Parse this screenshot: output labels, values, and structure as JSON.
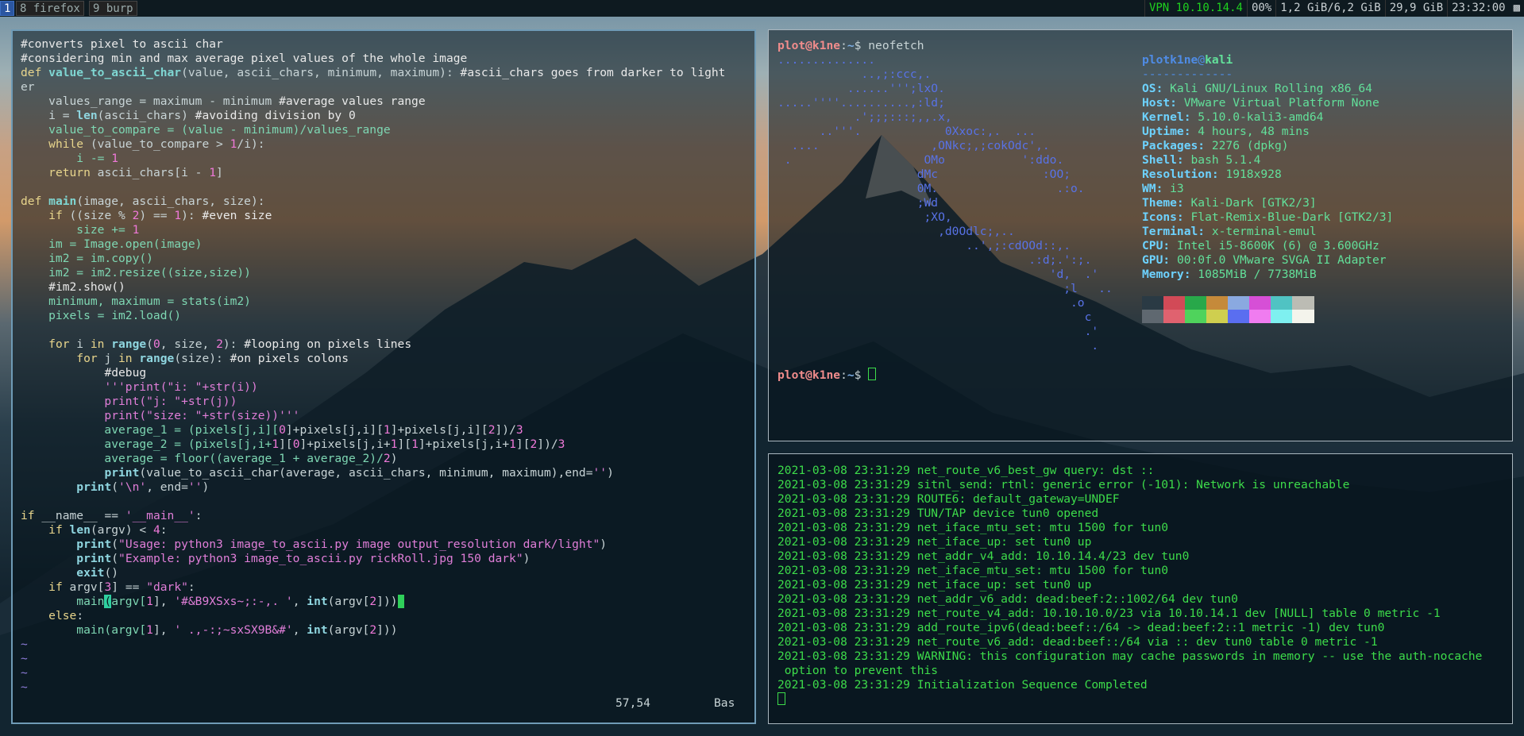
{
  "topbar": {
    "workspaces": [
      {
        "label": "1",
        "active": true
      },
      {
        "label": "8 firefox",
        "active": false
      },
      {
        "label": "9 burp",
        "active": false
      }
    ],
    "status": {
      "vpn": "VPN 10.10.14.4",
      "battery": "00%",
      "memory": "1,2 GiB/6,2 GiB",
      "disk": "29,9 GiB",
      "time": "23:32:00"
    }
  },
  "editor": {
    "lines": [
      "#converts pixel to ascii char",
      "#considering min and max average pixel values of the whole image",
      "def value_to_ascii_char(value, ascii_chars, minimum, maximum): #ascii_chars goes from darker to light",
      "er",
      "    values_range = maximum - minimum #average values range",
      "    i = len(ascii_chars) #avoiding division by 0",
      "    value_to_compare = (value - minimum)/values_range",
      "    while (value_to_compare > 1/i):",
      "        i -= 1",
      "    return ascii_chars[i - 1]",
      "",
      "def main(image, ascii_chars, size):",
      "    if ((size % 2) == 1): #even size",
      "        size += 1",
      "    im = Image.open(image)",
      "    im2 = im.copy()",
      "    im2 = im2.resize((size,size))",
      "    #im2.show()",
      "    minimum, maximum = stats(im2)",
      "    pixels = im2.load()",
      "",
      "    for i in range(0, size, 2): #looping on pixels lines",
      "        for j in range(size): #on pixels colons",
      "            #debug",
      "            '''print(\"i: \"+str(i))",
      "            print(\"j: \"+str(j))",
      "            print(\"size: \"+str(size))'''",
      "            average_1 = (pixels[j,i][0]+pixels[j,i][1]+pixels[j,i][2])/3",
      "            average_2 = (pixels[j,i+1][0]+pixels[j,i+1][1]+pixels[j,i+1][2])/3",
      "            average = floor((average_1 + average_2)/2)",
      "            print(value_to_ascii_char(average, ascii_chars, minimum, maximum),end='')",
      "        print('\\n', end='')",
      "",
      "if __name__ == '__main__':",
      "    if len(argv) < 4:",
      "        print(\"Usage: python3 image_to_ascii.py image output_resolution dark/light\")",
      "        print(\"Example: python3 image_to_ascii.py rickRoll.jpg 150 dark\")",
      "        exit()",
      "    if argv[3] == \"dark\":",
      "        main(argv[1], '#&B9XSxs~;:-,. ', int(argv[2]))",
      "    else:",
      "        main(argv[1], ' .,-:;~sxSX9B&#', int(argv[2]))",
      "~",
      "~",
      "~",
      "~"
    ],
    "position": "57,54",
    "mode": "Bas"
  },
  "neofetch": {
    "prompt_user": "plot@k1ne",
    "prompt_sep": ":",
    "prompt_path": "~",
    "prompt_symbol": "$",
    "command": "neofetch",
    "art": [
      "..............",
      "            ..,;:ccc,.",
      "          ......''';lxO.",
      ".....''''..........,:ld;",
      "           .';;;:::;,,.x,",
      "      ..'''.            0Xxoc:,.  ...",
      "  ....                ,ONkc;,;cokOdc',.",
      " .                   OMo           ':ddo.",
      "                    dMc               :OO;",
      "                    0M.                 .:o.",
      "                    ;Wd",
      "                     ;XO,",
      "                       ,d0Odlc;,..",
      "                           ..',;:cdOOd::,.",
      "                                    .:d;.':;.",
      "                                       'd,  .'",
      "                                         ;l   ..",
      "                                          .o",
      "                                            c",
      "                                            .'",
      "                                             ."
    ],
    "user": "plotk1ne",
    "at": "@",
    "host": "kali",
    "separator": "-------------",
    "info": [
      {
        "key": "OS",
        "value": "Kali GNU/Linux Rolling x86_64"
      },
      {
        "key": "Host",
        "value": "VMware Virtual Platform None"
      },
      {
        "key": "Kernel",
        "value": "5.10.0-kali3-amd64"
      },
      {
        "key": "Uptime",
        "value": "4 hours, 48 mins"
      },
      {
        "key": "Packages",
        "value": "2276 (dpkg)"
      },
      {
        "key": "Shell",
        "value": "bash 5.1.4"
      },
      {
        "key": "Resolution",
        "value": "1918x928"
      },
      {
        "key": "WM",
        "value": "i3"
      },
      {
        "key": "Theme",
        "value": "Kali-Dark [GTK2/3]"
      },
      {
        "key": "Icons",
        "value": "Flat-Remix-Blue-Dark [GTK2/3]"
      },
      {
        "key": "Terminal",
        "value": "x-terminal-emul"
      },
      {
        "key": "CPU",
        "value": "Intel i5-8600K (6) @ 3.600GHz"
      },
      {
        "key": "GPU",
        "value": "00:0f.0 VMware SVGA II Adapter"
      },
      {
        "key": "Memory",
        "value": "1085MiB / 7738MiB"
      }
    ],
    "colors_top": [
      "#2a3a44",
      "#d24a57",
      "#28a84a",
      "#c58a3a",
      "#8aa9e0",
      "#d64fd6",
      "#50c3c3",
      "#bcbcb4"
    ],
    "colors_bottom": [
      "#5f6870",
      "#e0626f",
      "#4fd35c",
      "#cfcf4f",
      "#5a6ef0",
      "#f07cf0",
      "#7ef0f0",
      "#f4f4ec"
    ]
  },
  "log": {
    "lines": [
      "2021-03-08 23:31:29 net_route_v6_best_gw query: dst ::",
      "2021-03-08 23:31:29 sitnl_send: rtnl: generic error (-101): Network is unreachable",
      "2021-03-08 23:31:29 ROUTE6: default_gateway=UNDEF",
      "2021-03-08 23:31:29 TUN/TAP device tun0 opened",
      "2021-03-08 23:31:29 net_iface_mtu_set: mtu 1500 for tun0",
      "2021-03-08 23:31:29 net_iface_up: set tun0 up",
      "2021-03-08 23:31:29 net_addr_v4_add: 10.10.14.4/23 dev tun0",
      "2021-03-08 23:31:29 net_iface_mtu_set: mtu 1500 for tun0",
      "2021-03-08 23:31:29 net_iface_up: set tun0 up",
      "2021-03-08 23:31:29 net_addr_v6_add: dead:beef:2::1002/64 dev tun0",
      "2021-03-08 23:31:29 net_route_v4_add: 10.10.10.0/23 via 10.10.14.1 dev [NULL] table 0 metric -1",
      "2021-03-08 23:31:29 add_route_ipv6(dead:beef::/64 -> dead:beef:2::1 metric -1) dev tun0",
      "2021-03-08 23:31:29 net_route_v6_add: dead:beef::/64 via :: dev tun0 table 0 metric -1",
      "2021-03-08 23:31:29 WARNING: this configuration may cache passwords in memory -- use the auth-nocache",
      " option to prevent this",
      "2021-03-08 23:31:29 Initialization Sequence Completed"
    ]
  }
}
